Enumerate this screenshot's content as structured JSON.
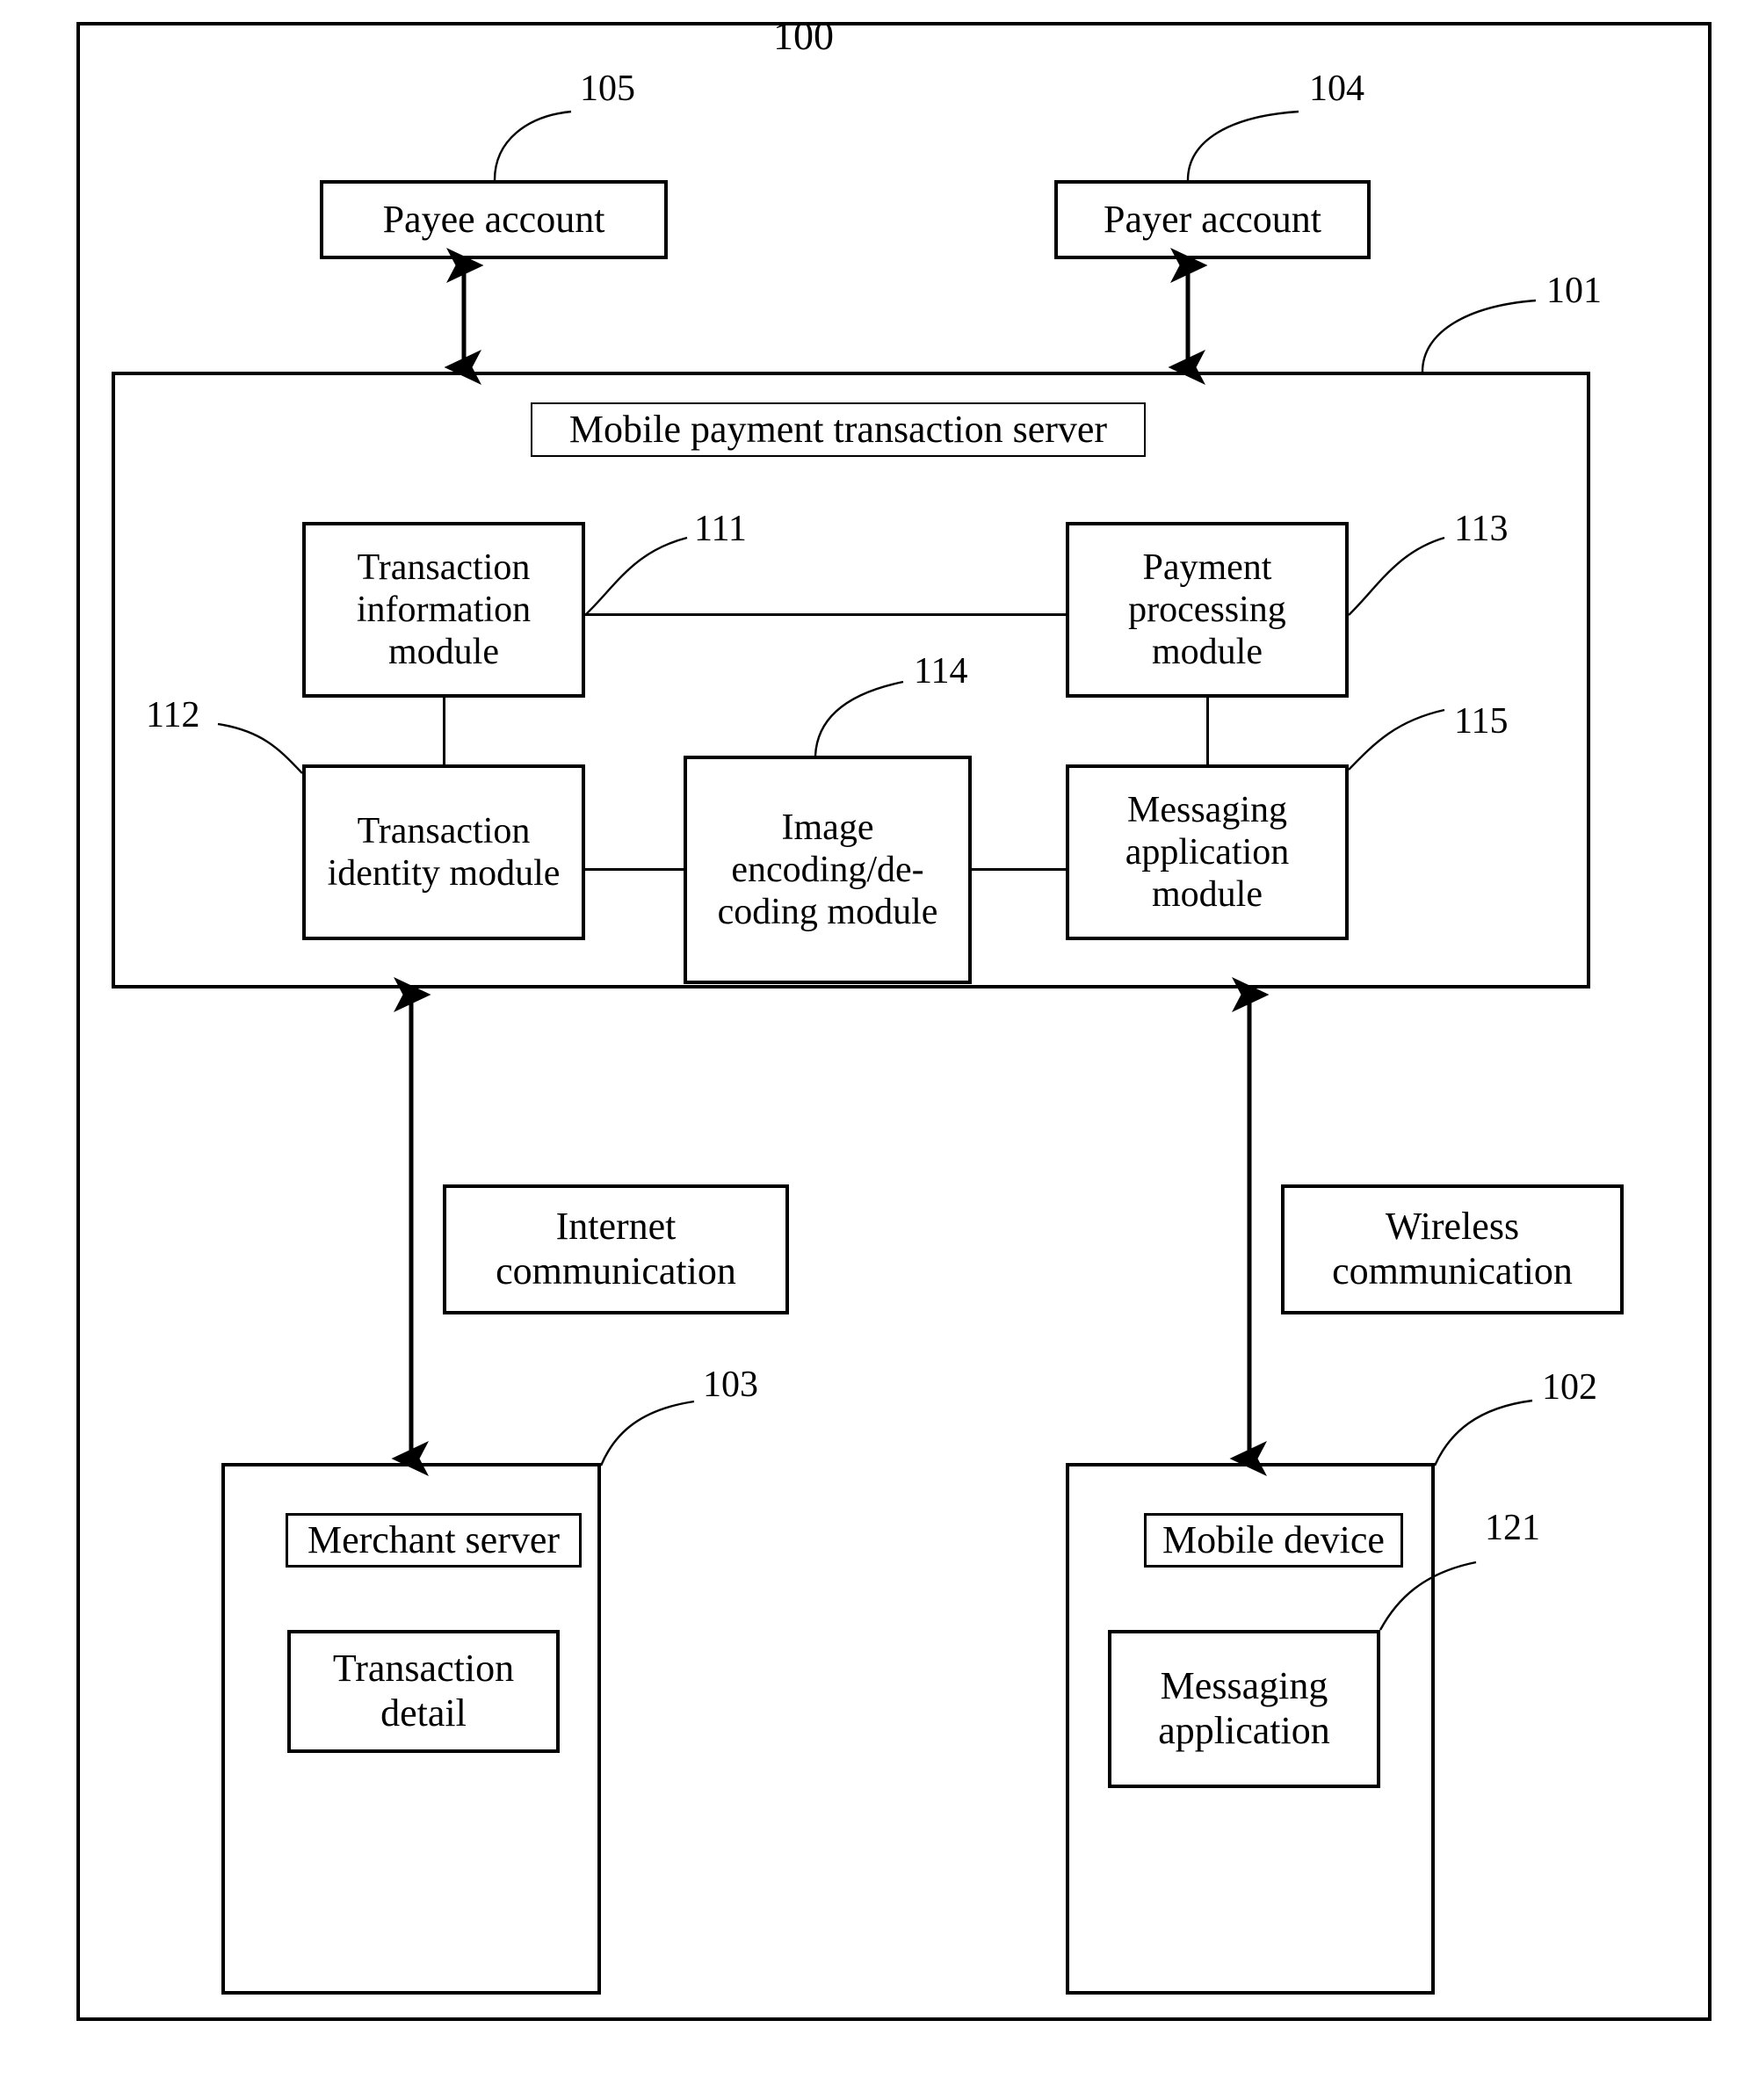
{
  "figure": {
    "number": "100",
    "outer_label": "100"
  },
  "accounts": {
    "payee": {
      "label": "Payee account",
      "ref": "105"
    },
    "payer": {
      "label": "Payer account",
      "ref": "104"
    }
  },
  "server": {
    "ref": "101",
    "title": "Mobile payment transaction server",
    "modules": [
      {
        "ref": "111",
        "label": "Transaction information module"
      },
      {
        "ref": "112",
        "label": "Transaction identity module"
      },
      {
        "ref": "113",
        "label": "Payment processing module"
      },
      {
        "ref": "114",
        "label": "Image encoding/de-coding module"
      },
      {
        "ref": "115",
        "label": "Messaging application module"
      }
    ]
  },
  "channels": {
    "internet": "Internet communication",
    "wireless": "Wireless communication"
  },
  "merchant": {
    "ref": "103",
    "title": "Merchant server",
    "inner": {
      "label": "Transaction detail"
    }
  },
  "mobile": {
    "ref": "102",
    "title": "Mobile device",
    "inner": {
      "ref": "121",
      "label": "Messaging application"
    }
  }
}
